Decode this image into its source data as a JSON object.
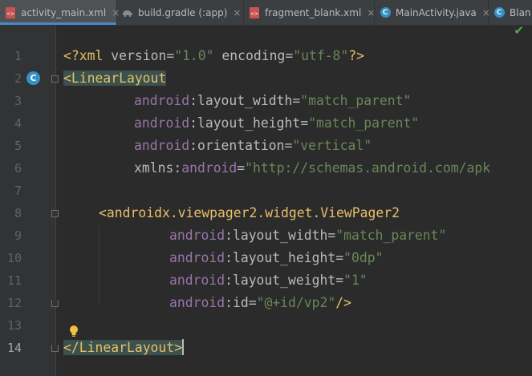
{
  "tabs": [
    {
      "label": "activity_main.xml",
      "icon": "xml-file-icon",
      "active": true,
      "close": "×"
    },
    {
      "label": "build.gradle (:app)",
      "icon": "gradle-elephant-icon",
      "active": false,
      "close": "×"
    },
    {
      "label": "fragment_blank.xml",
      "icon": "xml-file-icon",
      "active": false,
      "close": "×"
    },
    {
      "label": "MainActivity.java",
      "icon": "java-class-icon",
      "active": false,
      "close": "×"
    },
    {
      "label": "Blan",
      "icon": "java-class-icon",
      "active": false,
      "close": ""
    }
  ],
  "class_icon_letter": "C",
  "line_numbers": [
    "1",
    "2",
    "3",
    "4",
    "5",
    "6",
    "7",
    "8",
    "9",
    "10",
    "11",
    "12",
    "13",
    "14"
  ],
  "current_line": "14",
  "code": {
    "l1": {
      "a": "<?",
      "b": "xml ",
      "c": "version",
      "d": "=",
      "e": "\"1.0\"",
      "f": " encoding",
      "g": "=",
      "h": "\"utf-8\"",
      "i": "?>"
    },
    "l2": {
      "a": "<",
      "b": "LinearLayout"
    },
    "l3": {
      "ns": "android",
      "colon": ":",
      "attr": "layout_width",
      "eq": "=",
      "val": "\"match_parent\""
    },
    "l4": {
      "ns": "android",
      "colon": ":",
      "attr": "layout_height",
      "eq": "=",
      "val": "\"match_parent\""
    },
    "l5": {
      "ns": "android",
      "colon": ":",
      "attr": "orientation",
      "eq": "=",
      "val": "\"vertical\""
    },
    "l6": {
      "ns": "xmlns",
      "colon": ":",
      "attr": "android",
      "eq": "=",
      "val": "\"http://schemas.android.com/apk"
    },
    "l8": {
      "a": "<",
      "b": "androidx.viewpager2.widget.ViewPager2"
    },
    "l9": {
      "ns": "android",
      "colon": ":",
      "attr": "layout_width",
      "eq": "=",
      "val": "\"match_parent\""
    },
    "l10": {
      "ns": "android",
      "colon": ":",
      "attr": "layout_height",
      "eq": "=",
      "val": "\"0dp\""
    },
    "l11": {
      "ns": "android",
      "colon": ":",
      "attr": "layout_weight",
      "eq": "=",
      "val": "\"1\""
    },
    "l12": {
      "ns": "android",
      "colon": ":",
      "attr": "id",
      "eq": "=",
      "val": "\"@+id/vp2\"",
      "end": "/>"
    },
    "l14": {
      "a": "</",
      "b": "LinearLayout",
      "c": ">"
    }
  },
  "status_check": "✔",
  "colors": {
    "tag": "#e8bf6a",
    "namespace": "#9876aa",
    "value": "#6a8759",
    "attribute": "#bababa",
    "accent": "#4a88c7"
  }
}
